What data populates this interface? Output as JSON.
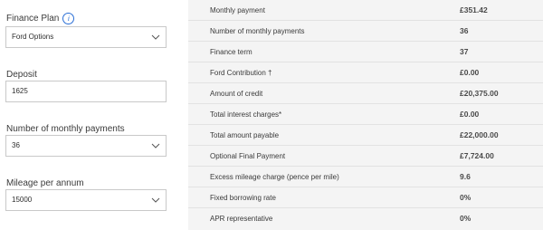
{
  "form": {
    "finance_plan": {
      "label": "Finance Plan",
      "value": "Ford Options",
      "info_icon": "info-icon"
    },
    "deposit": {
      "label": "Deposit",
      "value": "1625"
    },
    "monthly_payments": {
      "label": "Number of monthly payments",
      "value": "36"
    },
    "mileage": {
      "label": "Mileage per annum",
      "value": "15000"
    }
  },
  "summary": {
    "rows": [
      {
        "label": "Monthly payment",
        "value": "£351.42"
      },
      {
        "label": "Number of monthly payments",
        "value": "36"
      },
      {
        "label": "Finance term",
        "value": "37"
      },
      {
        "label": "Ford Contribution †",
        "value": "£0.00"
      },
      {
        "label": "Amount of credit",
        "value": "£20,375.00"
      },
      {
        "label": "Total interest charges*",
        "value": "£0.00"
      },
      {
        "label": "Total amount payable",
        "value": "£22,000.00"
      },
      {
        "label": "Optional Final Payment",
        "value": "£7,724.00"
      },
      {
        "label": "Excess mileage charge (pence per mile)",
        "value": "9.6"
      },
      {
        "label": "Fixed borrowing rate",
        "value": "0%"
      },
      {
        "label": "APR representative",
        "value": "0%"
      }
    ]
  },
  "colors": {
    "accent": "#2a6fd6",
    "panel": "#f4f4f4"
  }
}
